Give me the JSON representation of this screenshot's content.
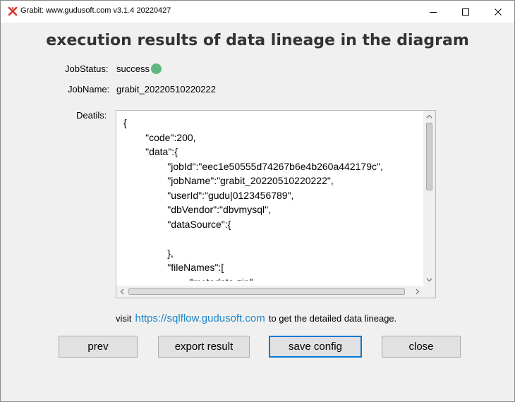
{
  "window": {
    "title": "Grabit: www.gudusoft.com  v3.1.4 20220427",
    "minimize_glyph": "minimize-icon",
    "maximize_glyph": "maximize-icon",
    "close_glyph": "close-icon"
  },
  "heading": "execution results of data lineage in the diagram",
  "job_status": {
    "label": "JobStatus:",
    "value": "success",
    "indicator_color": "#5cb87e"
  },
  "job_name": {
    "label": "JobName:",
    "value": "grabit_20220510220222"
  },
  "details": {
    "label": "Deatils:",
    "lines": [
      "{",
      "        \"code\":200,",
      "        \"data\":{",
      "                \"jobId\":\"eec1e50555d74267b6e4b260a442179c\",",
      "                \"jobName\":\"grabit_20220510220222\",",
      "                \"userId\":\"gudu|0123456789\",",
      "                \"dbVendor\":\"dbvmysql\",",
      "                \"dataSource\":{",
      "",
      "                },",
      "                \"fileNames\":[",
      "                        \"metadata.zip\""
    ]
  },
  "visit": {
    "prefix": "visit",
    "link": "https://sqlflow.gudusoft.com",
    "suffix": "to get the detailed data lineage.",
    "link_color": "#1e88c8"
  },
  "buttons": {
    "prev": "prev",
    "export": "export result",
    "save": "save config",
    "close": "close"
  },
  "colors": {
    "accent": "#0078d7",
    "background": "#f0f0f0"
  }
}
